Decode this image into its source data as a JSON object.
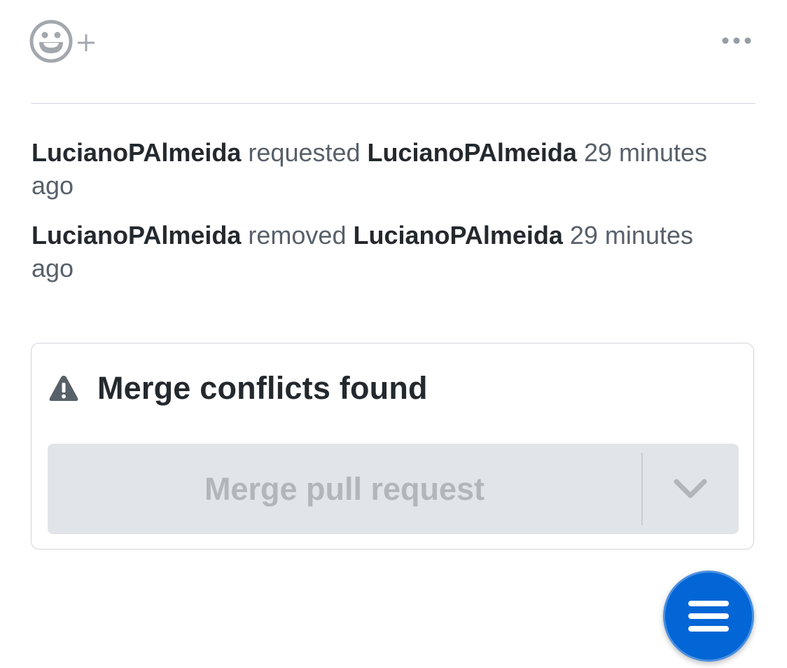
{
  "header": {
    "add_reaction_icon": "smiley-plus-icon",
    "more_icon": "kebab-horizontal-icon"
  },
  "timeline": [
    {
      "actor": "LucianoPAlmeida",
      "action": "requested",
      "target": "LucianoPAlmeida",
      "time": "29 minutes ago"
    },
    {
      "actor": "LucianoPAlmeida",
      "action": "removed",
      "target": "LucianoPAlmeida",
      "time": "29 minutes ago"
    }
  ],
  "merge": {
    "title": "Merge conflicts found",
    "warning_icon": "alert-icon",
    "button_label": "Merge pull request",
    "dropdown_icon": "chevron-down-icon"
  },
  "fab": {
    "icon": "hamburger-menu-icon",
    "color": "#0366d6"
  },
  "colors": {
    "text_primary": "#24292e",
    "text_secondary": "#586069",
    "disabled_text": "#b2b6bb",
    "disabled_bg": "#e1e4e8",
    "border": "#d1d5da"
  }
}
